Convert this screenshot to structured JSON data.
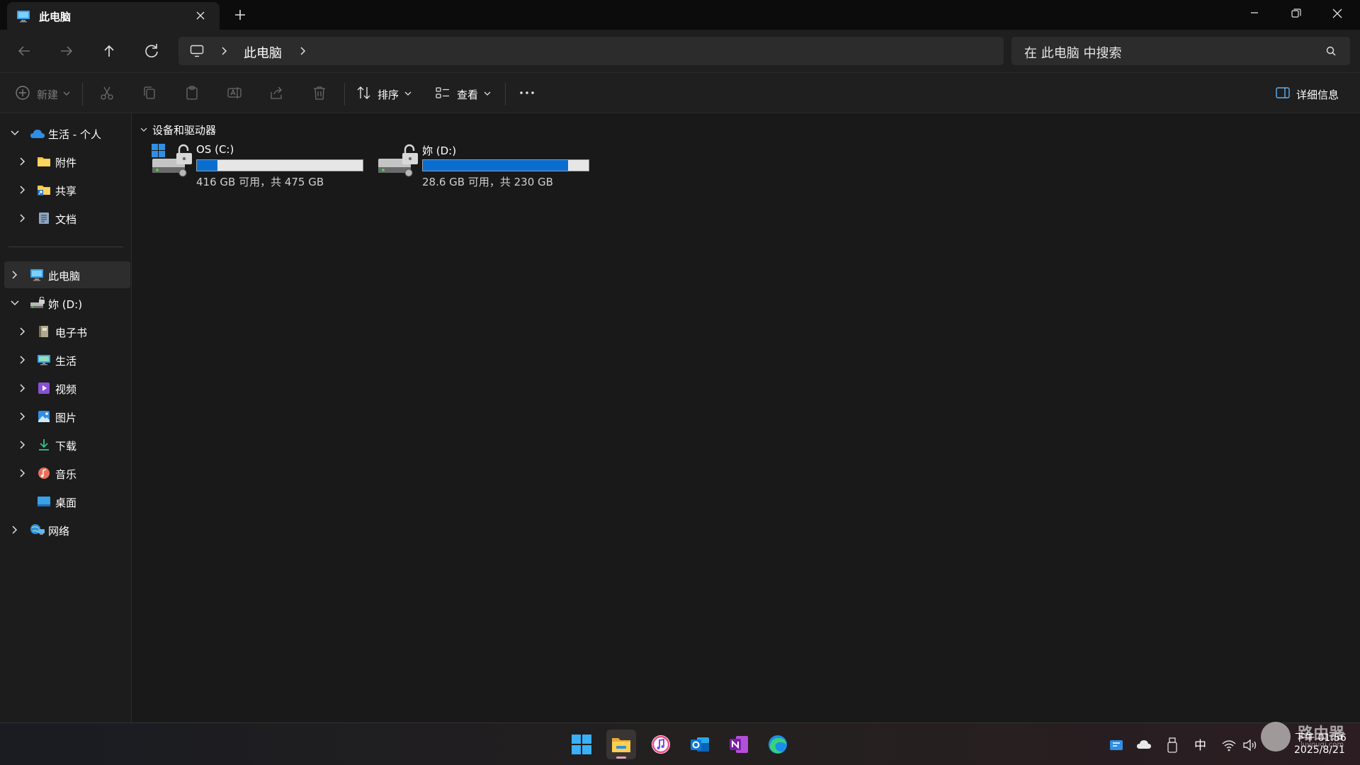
{
  "window": {
    "tab_title": "此电脑"
  },
  "address": {
    "breadcrumb": "此电脑",
    "search_placeholder": "在 此电脑 中搜索"
  },
  "toolbar": {
    "new_label": "新建",
    "sort_label": "排序",
    "view_label": "查看",
    "details_label": "详细信息"
  },
  "sidebar": {
    "items": [
      {
        "label": "生活 - 个人",
        "icon": "onedrive-cloud-icon",
        "expanded": true
      },
      {
        "label": "附件",
        "icon": "folder-icon"
      },
      {
        "label": "共享",
        "icon": "shared-folder-icon"
      },
      {
        "label": "文档",
        "icon": "document-icon"
      },
      {
        "label": "此电脑",
        "icon": "computer-icon",
        "selected": true
      },
      {
        "label": "妳 (D:)",
        "icon": "drive-icon",
        "expanded": true
      },
      {
        "label": "电子书",
        "icon": "ebook-icon"
      },
      {
        "label": "生活",
        "icon": "monitor-folder-icon"
      },
      {
        "label": "视频",
        "icon": "video-icon"
      },
      {
        "label": "图片",
        "icon": "picture-icon"
      },
      {
        "label": "下载",
        "icon": "download-icon"
      },
      {
        "label": "音乐",
        "icon": "music-icon"
      },
      {
        "label": "桌面",
        "icon": "desktop-icon"
      },
      {
        "label": "网络",
        "icon": "network-icon"
      }
    ]
  },
  "main": {
    "group_title": "设备和驱动器",
    "drives": [
      {
        "name": "OS (C:)",
        "free_text": "416 GB 可用，共 475 GB",
        "used_fraction": 0.124,
        "icon": "windows-drive-icon"
      },
      {
        "name": "妳 (D:)",
        "free_text": "28.6 GB 可用，共 230 GB",
        "used_fraction": 0.876,
        "icon": "drive-icon"
      }
    ]
  },
  "taskbar": {
    "apps": [
      "start-icon",
      "file-explorer-icon",
      "itunes-icon",
      "outlook-icon",
      "onenote-icon",
      "edge-icon"
    ],
    "ime": "中",
    "time": "下午 01:56",
    "date": "2025/8/21"
  },
  "watermark": {
    "text": "路由器",
    "url": "luyouqi.com"
  },
  "colors": {
    "accent": "#0a6ed1",
    "background": "#191919",
    "panel": "#1f1f1f"
  }
}
